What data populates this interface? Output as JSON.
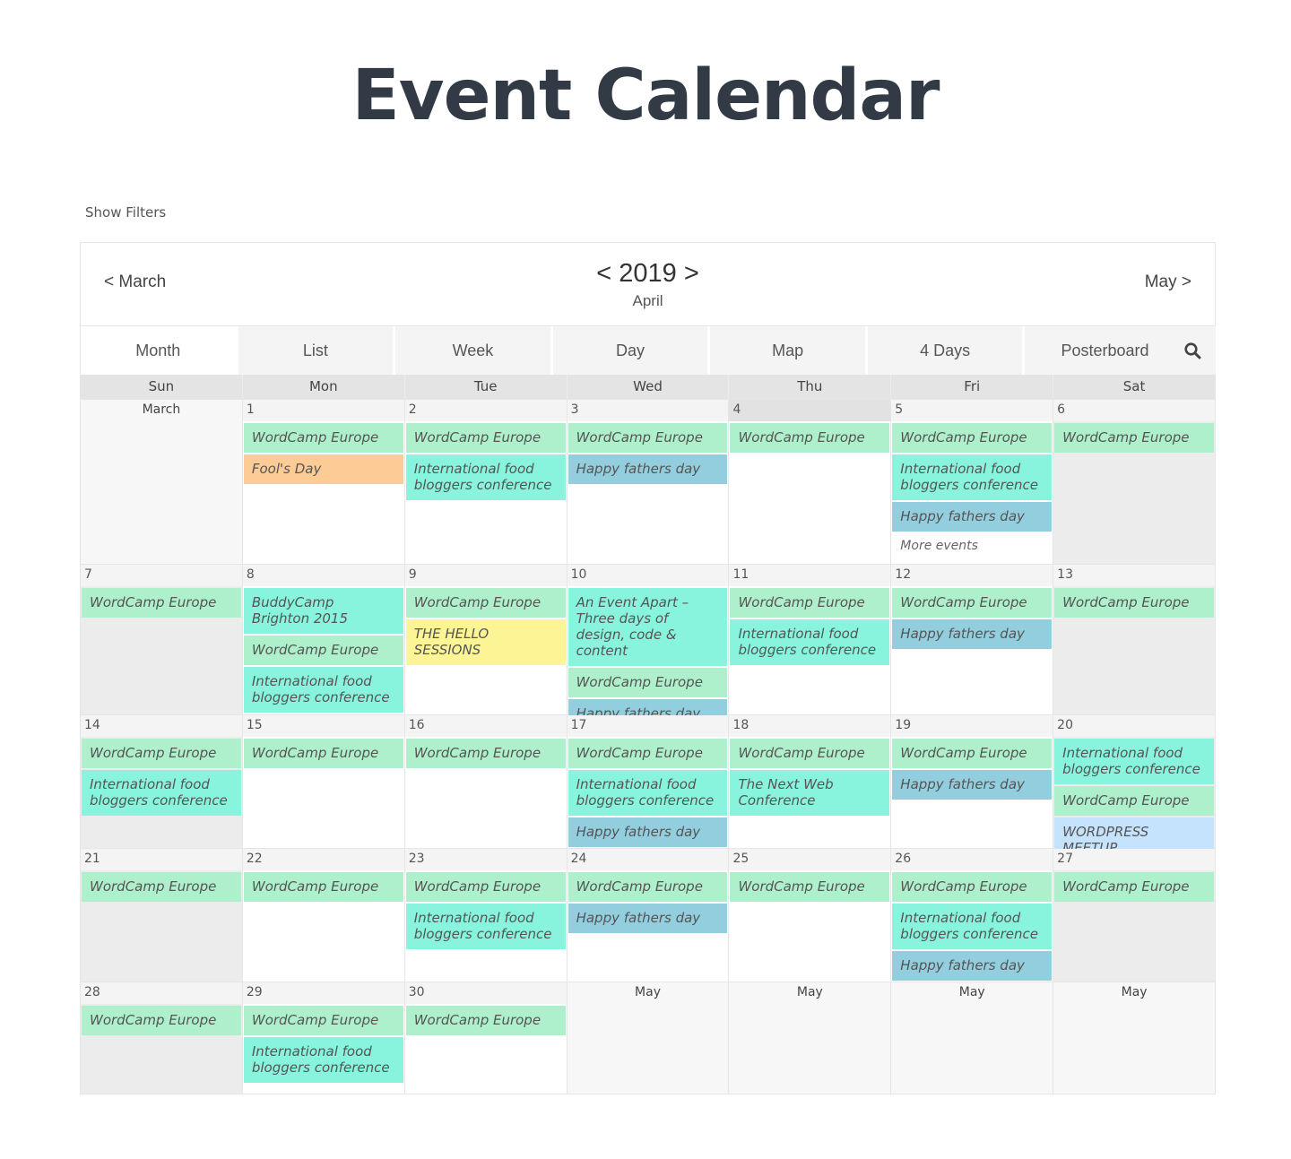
{
  "page": {
    "title": "Event Calendar",
    "show_filters": "Show Filters"
  },
  "nav": {
    "prev": "< March",
    "next": "May >",
    "year_prev": "<",
    "year": "2019",
    "year_next": ">",
    "month": "April"
  },
  "views": [
    {
      "label": "Month",
      "active": true
    },
    {
      "label": "List",
      "active": false
    },
    {
      "label": "Week",
      "active": false
    },
    {
      "label": "Day",
      "active": false
    },
    {
      "label": "Map",
      "active": false
    },
    {
      "label": "4 Days",
      "active": false
    },
    {
      "label": "Posterboard",
      "active": false
    }
  ],
  "search_icon": "search-icon",
  "colors": {
    "wordcamp": "#aef0cb",
    "conference": "#88f4dd",
    "fathers": "#93cedf",
    "fools": "#fdcb96",
    "hello": "#fdf495",
    "meetup": "#c6e3fd"
  },
  "weekdays": [
    "Sun",
    "Mon",
    "Tue",
    "Wed",
    "Thu",
    "Fri",
    "Sat"
  ],
  "weeks": [
    [
      {
        "label": "March",
        "other": true,
        "events": []
      },
      {
        "label": "1",
        "events": [
          {
            "title": "WordCamp Europe",
            "type": "wordcamp"
          },
          {
            "title": "Fool's Day",
            "type": "fools"
          }
        ]
      },
      {
        "label": "2",
        "events": [
          {
            "title": "WordCamp Europe",
            "type": "wordcamp"
          },
          {
            "title": "International food bloggers conference",
            "type": "conference"
          }
        ]
      },
      {
        "label": "3",
        "events": [
          {
            "title": "WordCamp Europe",
            "type": "wordcamp"
          },
          {
            "title": "Happy fathers day",
            "type": "fathers"
          }
        ]
      },
      {
        "label": "4",
        "today": true,
        "events": [
          {
            "title": "WordCamp Europe",
            "type": "wordcamp"
          }
        ]
      },
      {
        "label": "5",
        "events": [
          {
            "title": "WordCamp Europe",
            "type": "wordcamp"
          },
          {
            "title": "International food bloggers conference",
            "type": "conference"
          },
          {
            "title": "Happy fathers day",
            "type": "fathers"
          }
        ],
        "more": "More events"
      },
      {
        "label": "6",
        "events": [
          {
            "title": "WordCamp Europe",
            "type": "wordcamp"
          }
        ]
      }
    ],
    [
      {
        "label": "7",
        "events": [
          {
            "title": "WordCamp Europe",
            "type": "wordcamp"
          }
        ]
      },
      {
        "label": "8",
        "events": [
          {
            "title": "BuddyCamp Brighton 2015",
            "type": "conference"
          },
          {
            "title": "WordCamp Europe",
            "type": "wordcamp"
          },
          {
            "title": "International food bloggers conference",
            "type": "conference"
          }
        ]
      },
      {
        "label": "9",
        "events": [
          {
            "title": "WordCamp Europe",
            "type": "wordcamp"
          },
          {
            "title": "THE HELLO SESSIONS",
            "type": "hello"
          }
        ]
      },
      {
        "label": "10",
        "events": [
          {
            "title": "An Event Apart – Three days of design, code & content",
            "type": "conference"
          },
          {
            "title": "WordCamp Europe",
            "type": "wordcamp"
          },
          {
            "title": "Happy fathers day",
            "type": "fathers"
          }
        ]
      },
      {
        "label": "11",
        "events": [
          {
            "title": "WordCamp Europe",
            "type": "wordcamp"
          },
          {
            "title": "International food bloggers conference",
            "type": "conference"
          }
        ]
      },
      {
        "label": "12",
        "events": [
          {
            "title": "WordCamp Europe",
            "type": "wordcamp"
          },
          {
            "title": "Happy fathers day",
            "type": "fathers"
          }
        ]
      },
      {
        "label": "13",
        "events": [
          {
            "title": "WordCamp Europe",
            "type": "wordcamp"
          }
        ]
      }
    ],
    [
      {
        "label": "14",
        "events": [
          {
            "title": "WordCamp Europe",
            "type": "wordcamp"
          },
          {
            "title": "International food bloggers conference",
            "type": "conference"
          }
        ]
      },
      {
        "label": "15",
        "events": [
          {
            "title": "WordCamp Europe",
            "type": "wordcamp"
          }
        ]
      },
      {
        "label": "16",
        "events": [
          {
            "title": "WordCamp Europe",
            "type": "wordcamp"
          }
        ]
      },
      {
        "label": "17",
        "events": [
          {
            "title": "WordCamp Europe",
            "type": "wordcamp"
          },
          {
            "title": "International food bloggers conference",
            "type": "conference"
          },
          {
            "title": "Happy fathers day",
            "type": "fathers"
          }
        ]
      },
      {
        "label": "18",
        "events": [
          {
            "title": "WordCamp Europe",
            "type": "wordcamp"
          },
          {
            "title": "The Next Web Conference",
            "type": "conference"
          }
        ]
      },
      {
        "label": "19",
        "events": [
          {
            "title": "WordCamp Europe",
            "type": "wordcamp"
          },
          {
            "title": "Happy fathers day",
            "type": "fathers"
          }
        ]
      },
      {
        "label": "20",
        "events": [
          {
            "title": "International food bloggers conference",
            "type": "conference"
          },
          {
            "title": "WordCamp Europe",
            "type": "wordcamp"
          },
          {
            "title": "WORDPRESS MEETUP",
            "type": "meetup"
          }
        ]
      }
    ],
    [
      {
        "label": "21",
        "events": [
          {
            "title": "WordCamp Europe",
            "type": "wordcamp"
          }
        ]
      },
      {
        "label": "22",
        "events": [
          {
            "title": "WordCamp Europe",
            "type": "wordcamp"
          }
        ]
      },
      {
        "label": "23",
        "events": [
          {
            "title": "WordCamp Europe",
            "type": "wordcamp"
          },
          {
            "title": "International food bloggers conference",
            "type": "conference"
          }
        ]
      },
      {
        "label": "24",
        "events": [
          {
            "title": "WordCamp Europe",
            "type": "wordcamp"
          },
          {
            "title": "Happy fathers day",
            "type": "fathers"
          }
        ]
      },
      {
        "label": "25",
        "events": [
          {
            "title": "WordCamp Europe",
            "type": "wordcamp"
          }
        ]
      },
      {
        "label": "26",
        "events": [
          {
            "title": "WordCamp Europe",
            "type": "wordcamp"
          },
          {
            "title": "International food bloggers conference",
            "type": "conference"
          },
          {
            "title": "Happy fathers day",
            "type": "fathers"
          }
        ]
      },
      {
        "label": "27",
        "events": [
          {
            "title": "WordCamp Europe",
            "type": "wordcamp"
          }
        ]
      }
    ],
    [
      {
        "label": "28",
        "events": [
          {
            "title": "WordCamp Europe",
            "type": "wordcamp"
          }
        ]
      },
      {
        "label": "29",
        "events": [
          {
            "title": "WordCamp Europe",
            "type": "wordcamp"
          },
          {
            "title": "International food bloggers conference",
            "type": "conference"
          }
        ]
      },
      {
        "label": "30",
        "events": [
          {
            "title": "WordCamp Europe",
            "type": "wordcamp"
          }
        ]
      },
      {
        "label": "May",
        "other": true,
        "events": []
      },
      {
        "label": "May",
        "other": true,
        "events": []
      },
      {
        "label": "May",
        "other": true,
        "events": []
      },
      {
        "label": "May",
        "other": true,
        "events": []
      }
    ]
  ]
}
